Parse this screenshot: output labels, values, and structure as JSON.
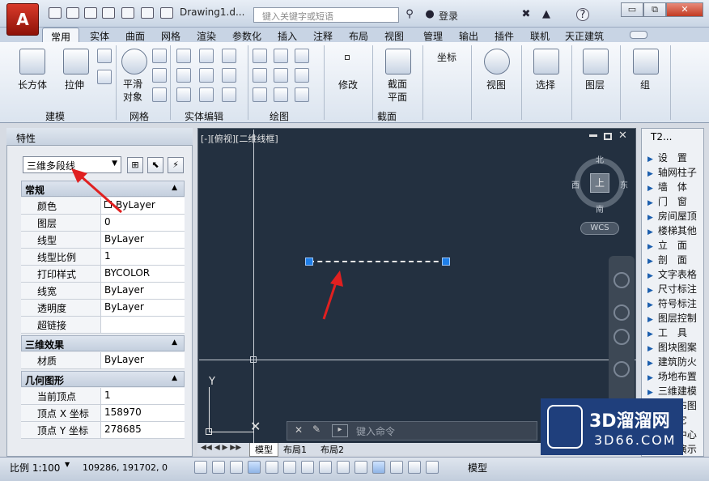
{
  "titlebar": {
    "app_logo": "A",
    "doc_title": "Drawing1.d...",
    "search_placeholder": "键入关键字或短语",
    "login": "登录",
    "help": "?",
    "win_minimize": "▭",
    "win_restore": "⧉",
    "win_close": "✕"
  },
  "tabs": [
    "常用",
    "实体",
    "曲面",
    "网格",
    "渲染",
    "参数化",
    "插入",
    "注释",
    "布局",
    "视图",
    "管理",
    "输出",
    "插件",
    "联机",
    "天正建筑"
  ],
  "ribbon": {
    "box_label": "长方体",
    "extrude_label": "拉伸",
    "smooth_label": "平滑\n对象",
    "modeling_panel": "建模",
    "mesh_panel": "网格",
    "solid_edit_panel": "实体编辑",
    "draw_panel": "绘图",
    "modify_label": "修改",
    "section_label": "截面\n平面",
    "section_panel": "截面",
    "ucs_label": "坐标",
    "view_label": "视图",
    "select_label": "选择",
    "layers_label": "图层",
    "group_label": "组"
  },
  "properties": {
    "palette_title": "特性",
    "selected_type": "三维多段线",
    "sections": [
      {
        "title": "常规",
        "rows": [
          {
            "name": "颜色",
            "value": "ByLayer"
          },
          {
            "name": "图层",
            "value": "0"
          },
          {
            "name": "线型",
            "value": "ByLayer"
          },
          {
            "name": "线型比例",
            "value": "1"
          },
          {
            "name": "打印样式",
            "value": "BYCOLOR"
          },
          {
            "name": "线宽",
            "value": "ByLayer"
          },
          {
            "name": "透明度",
            "value": "ByLayer"
          },
          {
            "name": "超链接",
            "value": ""
          }
        ]
      },
      {
        "title": "三维效果",
        "rows": [
          {
            "name": "材质",
            "value": "ByLayer"
          }
        ]
      },
      {
        "title": "几何图形",
        "rows": [
          {
            "name": "当前顶点",
            "value": "1"
          },
          {
            "name": "顶点 X 坐标",
            "value": "158970"
          },
          {
            "name": "顶点 Y 坐标",
            "value": "278685"
          }
        ]
      }
    ]
  },
  "viewport": {
    "label": "[-][俯视][二维线框]",
    "cube_top": "上",
    "north": "北",
    "south": "南",
    "east": "东",
    "west": "西",
    "wcs": "WCS",
    "ucs_y": "Y",
    "cmd_placeholder": "键入命令",
    "layout_tabs": [
      "模型",
      "布局1",
      "布局2"
    ]
  },
  "t2": {
    "title": "T2...",
    "items": [
      "设　置",
      "轴网柱子",
      "墙　体",
      "门　窗",
      "房间屋顶",
      "楼梯其他",
      "立　面",
      "剖　面",
      "文字表格",
      "尺寸标注",
      "符号标注",
      "图层控制",
      "工　具",
      "图块图案",
      "建筑防火",
      "场地布置",
      "三维建模",
      "文件布图",
      "其　它",
      "帮助中心",
      "在线演示"
    ]
  },
  "watermark": {
    "brand": "3D溜溜网",
    "site": "3D66.COM"
  },
  "status": {
    "scale": "比例 1:100",
    "coords": "109286, 191702, 0",
    "model": "模型"
  },
  "colors": {
    "accent": "#1e7ee8",
    "viewport_bg": "#233040",
    "annotation": "#e02020"
  }
}
